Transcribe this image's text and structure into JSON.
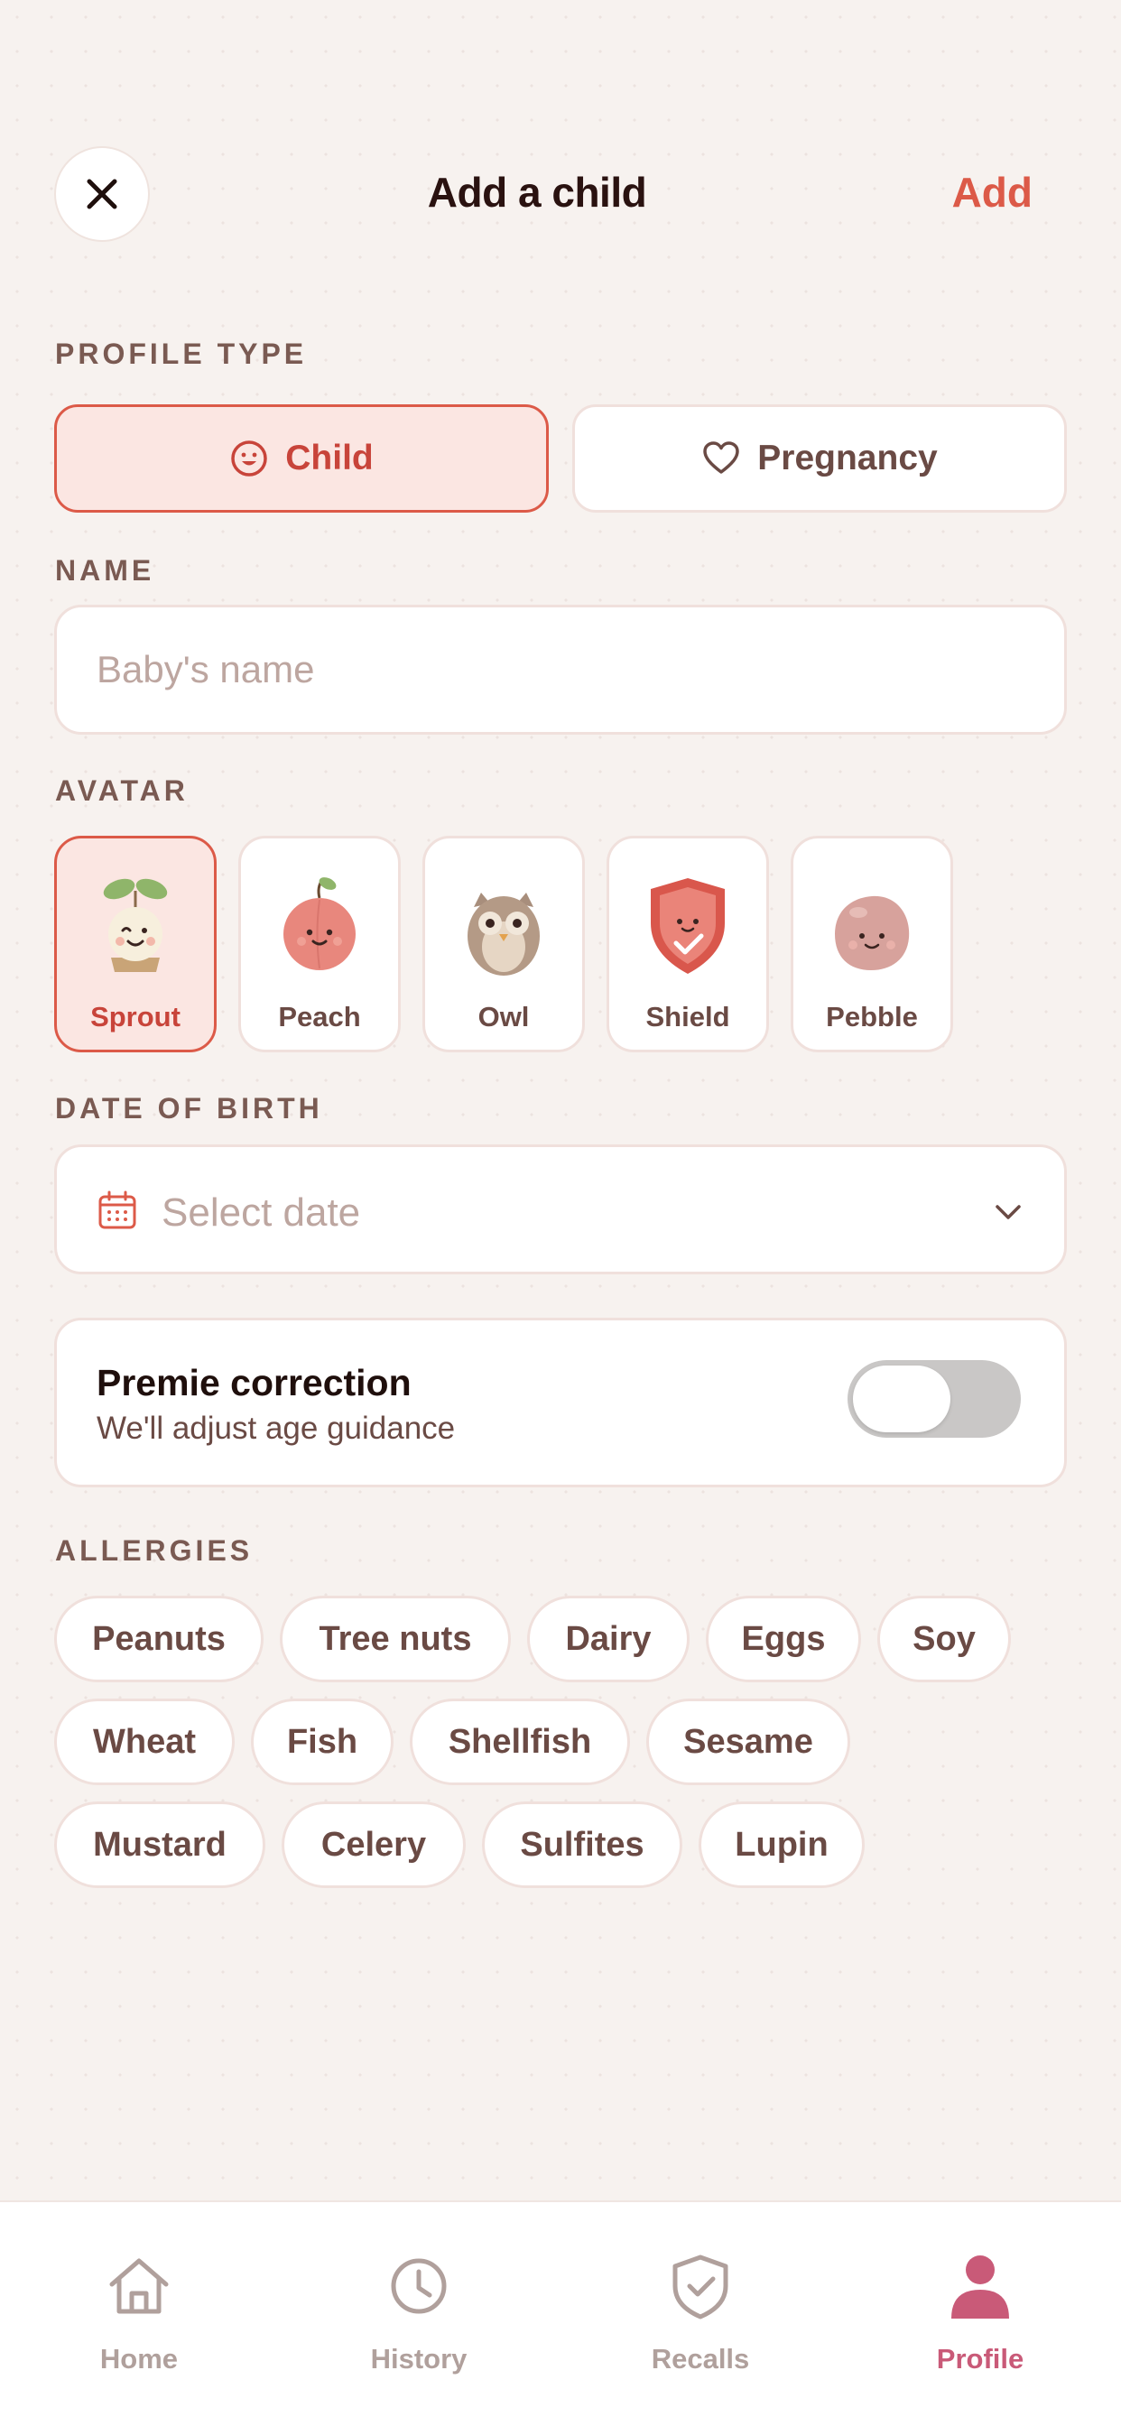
{
  "header": {
    "title": "Add a child",
    "add_label": "Add"
  },
  "profile_type": {
    "label": "PROFILE TYPE",
    "options": [
      {
        "label": "Child",
        "icon": "smiley-icon",
        "selected": true
      },
      {
        "label": "Pregnancy",
        "icon": "heart-icon",
        "selected": false
      }
    ]
  },
  "name": {
    "label": "NAME",
    "placeholder": "Baby's name",
    "value": ""
  },
  "avatar": {
    "label": "AVATAR",
    "options": [
      {
        "label": "Sprout",
        "selected": true
      },
      {
        "label": "Peach",
        "selected": false
      },
      {
        "label": "Owl",
        "selected": false
      },
      {
        "label": "Shield",
        "selected": false
      },
      {
        "label": "Pebble",
        "selected": false
      }
    ]
  },
  "date_of_birth": {
    "label": "DATE OF BIRTH",
    "placeholder": "Select date"
  },
  "premie": {
    "title": "Premie correction",
    "subtitle": "We'll adjust age guidance",
    "enabled": false
  },
  "allergies": {
    "label": "ALLERGIES",
    "items": [
      "Peanuts",
      "Tree nuts",
      "Dairy",
      "Eggs",
      "Soy",
      "Wheat",
      "Fish",
      "Shellfish",
      "Sesame",
      "Mustard",
      "Celery",
      "Sulfites",
      "Lupin"
    ]
  },
  "tabs": [
    {
      "label": "Home",
      "icon": "home-icon",
      "active": false
    },
    {
      "label": "History",
      "icon": "clock-icon",
      "active": false
    },
    {
      "label": "Recalls",
      "icon": "shield-check-icon",
      "active": false
    },
    {
      "label": "Profile",
      "icon": "person-icon",
      "active": true
    }
  ],
  "colors": {
    "accent": "#dc5a48",
    "active_tab": "#c95a78",
    "background": "#f7f2ef"
  }
}
